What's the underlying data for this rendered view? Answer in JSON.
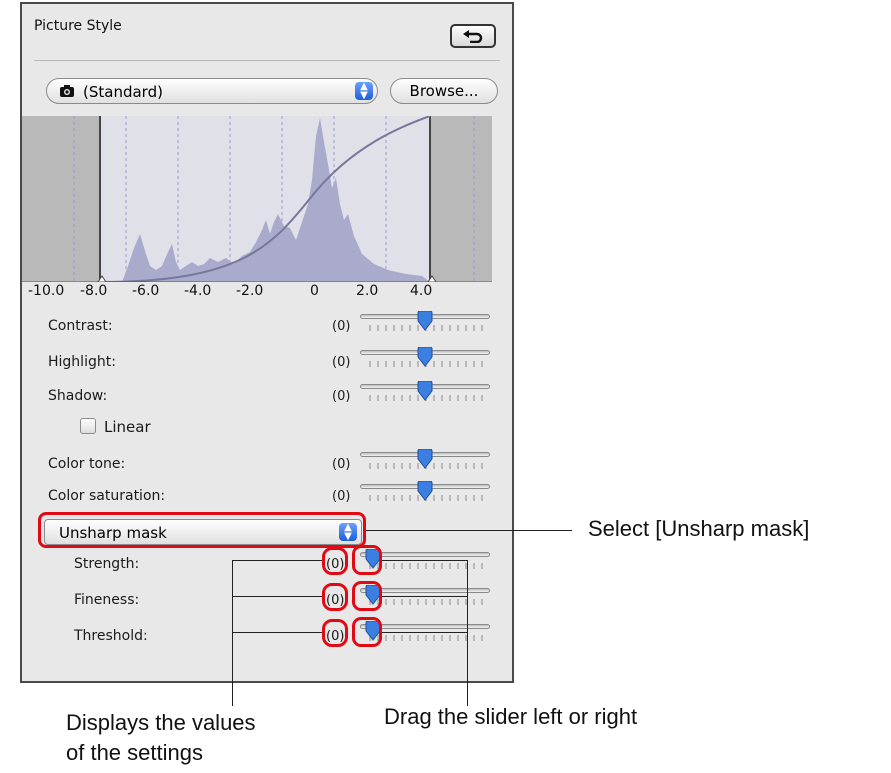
{
  "panel": {
    "title": "Picture Style",
    "reset_icon": "undo-arrow-icon",
    "style_select": {
      "icon": "camera-icon",
      "value": "(Standard)"
    },
    "browse_label": "Browse...",
    "histogram": {
      "tick_labels": [
        "-10.0",
        "-8.0",
        "-6.0",
        "-4.0",
        "-2.0",
        "0",
        "2.0",
        "4.0"
      ]
    },
    "sliders": [
      {
        "label": "Contrast:",
        "value": "(0)",
        "level": 0.5
      },
      {
        "label": "Highlight:",
        "value": "(0)",
        "level": 0.5
      },
      {
        "label": "Shadow:",
        "value": "(0)",
        "level": 0.5
      }
    ],
    "linear_label": "Linear",
    "color_sliders": [
      {
        "label": "Color tone:",
        "value": "(0)",
        "level": 0.5
      },
      {
        "label": "Color saturation:",
        "value": "(0)",
        "level": 0.5
      }
    ],
    "sharpness_select": "Unsharp mask",
    "sharp_sliders": [
      {
        "label": "Strength:",
        "value": "(0)",
        "level": 0
      },
      {
        "label": "Fineness:",
        "value": "(0)",
        "level": 0
      },
      {
        "label": "Threshold:",
        "value": "(0)",
        "level": 0
      }
    ]
  },
  "callouts": {
    "select": "Select [Unsharp mask]",
    "values": "Displays the values\nof the settings",
    "drag": "Drag the slider left or right"
  },
  "colors": {
    "highlight": "#e10a14",
    "thumb": "#3b7fe0",
    "panel": "#e8e8e8"
  }
}
